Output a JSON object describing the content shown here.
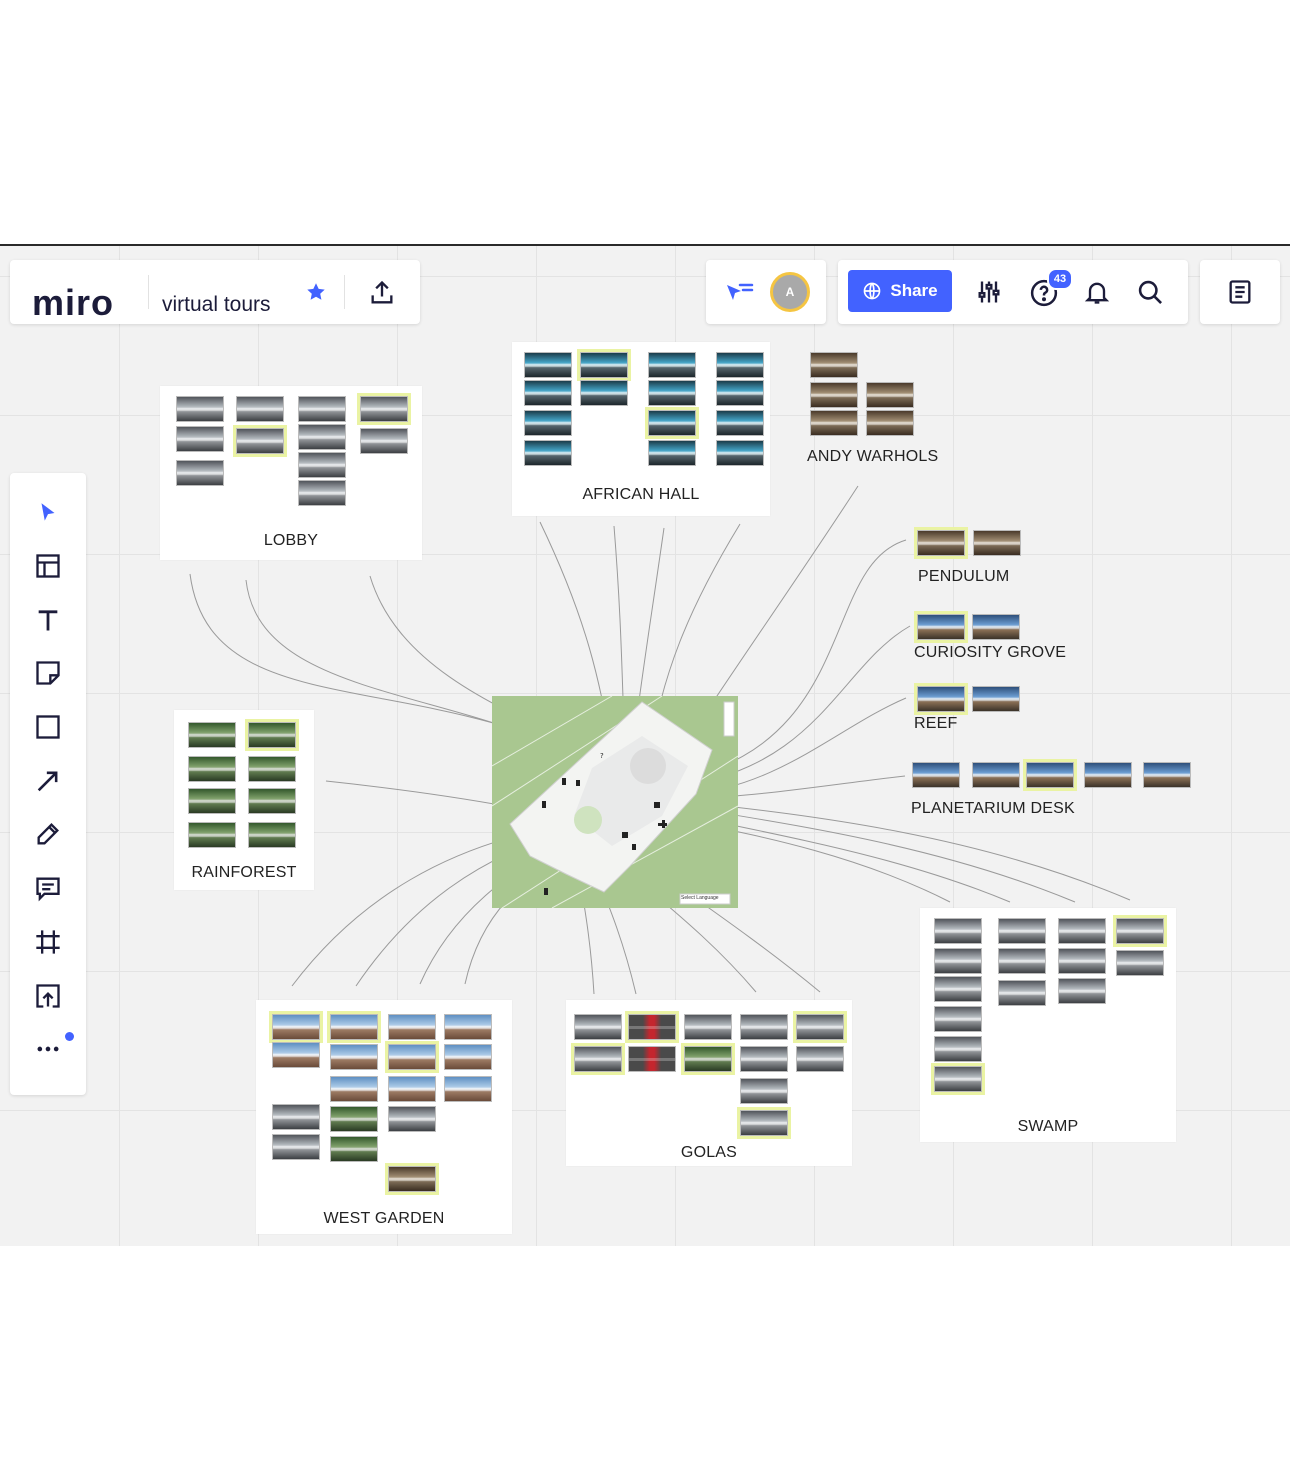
{
  "app": {
    "logo": "miro",
    "board_title": "virtual tours",
    "notification_count": "43",
    "avatar_initial": "A",
    "share_label": "Share",
    "accent": "#4262ff",
    "avatar_ring": "#f5c542"
  },
  "toolbar": {
    "tools": [
      "select-icon",
      "templates-icon",
      "text-icon",
      "sticky-note-icon",
      "shape-icon",
      "arrow-icon",
      "pen-icon",
      "comment-icon",
      "frame-icon",
      "upload-icon",
      "more-icon"
    ]
  },
  "frames": {
    "lobby": "LOBBY",
    "african_hall": "AFRICAN HALL",
    "andy_warhols": "ANDY WARHOLS",
    "pendulum": "PENDULUM",
    "curiosity_grove": "CURIOSITY GROVE",
    "reef": "REEF",
    "planetarium_desk": "PLANETARIUM DESK",
    "rainforest": "RAINFOREST",
    "west_garden": "WEST GARDEN",
    "golas": "GOLAS",
    "swamp": "SWAMP"
  },
  "map": {
    "language_select": "Select Language"
  }
}
